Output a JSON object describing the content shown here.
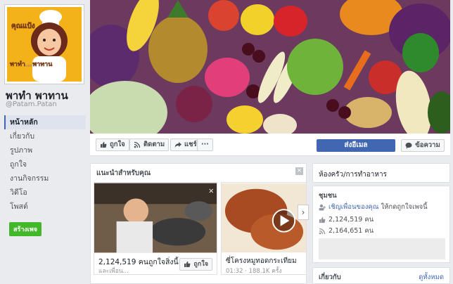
{
  "page": {
    "name": "พาทำ พาทาน",
    "handle": "@Patam.Patan",
    "logo_text_top": "คุณแป้ง",
    "logo_text_bottom": "พาทำ...พาทาน"
  },
  "nav": {
    "items": [
      "หน้าหลัก",
      "เกี่ยวกับ",
      "รูปภาพ",
      "ถูกใจ",
      "งานกิจกรรม",
      "วิดีโอ",
      "โพสต์"
    ]
  },
  "create_button": "สร้างเพจ",
  "actions": {
    "like": "ถูกใจ",
    "follow": "ติดตาม",
    "share": "แชร์",
    "more": "···",
    "send": "ส่งอีเมล",
    "message": "ข้อความ"
  },
  "suggest": {
    "title": "แนะนำสำหรับคุณ",
    "cards": [
      {
        "text": "2,124,519 คนถูกใจสิ่งนี้",
        "sub": "และเพื่อน...",
        "like": "ถูกใจ"
      },
      {
        "text": "ซี่โครงหมูทอดกระเทียม",
        "sub": "01:32 · 188.1K ครั้ง"
      }
    ]
  },
  "right": {
    "title": "ห้องครัว/การทำอาหาร",
    "community_label": "ชุมชน",
    "invite_link": "เชิญเพื่อนของคุณ",
    "invite_rest": " ให้กดถูกใจเพจนี้",
    "likes": "2,124,519 คน",
    "follows": "2,164,651 คน",
    "about": "เกี่ยวกับ",
    "see_all": "ดูทั้งหมด"
  },
  "colors": {
    "brand": "#4267b2",
    "green": "#42b72a",
    "bg": "#e9ebee"
  }
}
